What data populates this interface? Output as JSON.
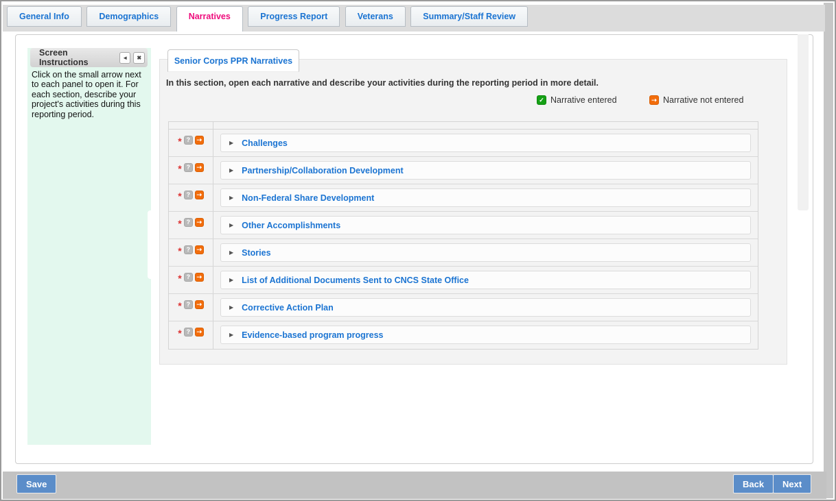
{
  "tabs": {
    "items": [
      {
        "label": "General Info",
        "active": false
      },
      {
        "label": "Demographics",
        "active": false
      },
      {
        "label": "Narratives",
        "active": true
      },
      {
        "label": "Progress Report",
        "active": false
      },
      {
        "label": "Veterans",
        "active": false
      },
      {
        "label": "Summary/Staff Review",
        "active": false
      }
    ]
  },
  "instructions_panel": {
    "title": "Screen Instructions",
    "collapse_glyph": "◄",
    "close_glyph": "✖",
    "body": "Click on the small arrow next to each panel to open it. For each section, describe your project's activities during this reporting period."
  },
  "main_panel": {
    "title": "Senior Corps PPR Narratives",
    "intro": "In this section, open each narrative and describe your activities during the reporting period in more detail.",
    "legend": {
      "entered": {
        "label": "Narrative entered",
        "glyph": "✓",
        "color": "#15a015"
      },
      "not_entered": {
        "label": "Narrative not entered",
        "glyph": "⇢",
        "color": "#f26d0c"
      }
    },
    "required_marker": "*",
    "help_glyph": "?",
    "status_glyph": "⇢",
    "expand_glyph": "▶",
    "narratives": [
      {
        "title": "Challenges",
        "required": true,
        "status": "not entered"
      },
      {
        "title": "Partnership/Collaboration Development",
        "required": true,
        "status": "not entered"
      },
      {
        "title": "Non-Federal Share Development",
        "required": true,
        "status": "not entered"
      },
      {
        "title": "Other Accomplishments",
        "required": true,
        "status": "not entered"
      },
      {
        "title": "Stories",
        "required": true,
        "status": "not entered"
      },
      {
        "title": "List of Additional Documents Sent to CNCS State Office",
        "required": true,
        "status": "not entered"
      },
      {
        "title": "Corrective Action Plan",
        "required": true,
        "status": "not entered"
      },
      {
        "title": "Evidence-based program progress",
        "required": true,
        "status": "not entered"
      }
    ]
  },
  "footer": {
    "save_label": "Save",
    "back_label": "Back",
    "next_label": "Next"
  },
  "colors": {
    "active_tab_text": "#ee0c7c",
    "tab_text": "#1b74d2",
    "narrative_title": "#1b74d2",
    "entered_icon": "#15a015",
    "not_entered_icon": "#f26d0c",
    "button_blue": "#5b8dc9",
    "instructions_bg": "#e3f8ee"
  }
}
